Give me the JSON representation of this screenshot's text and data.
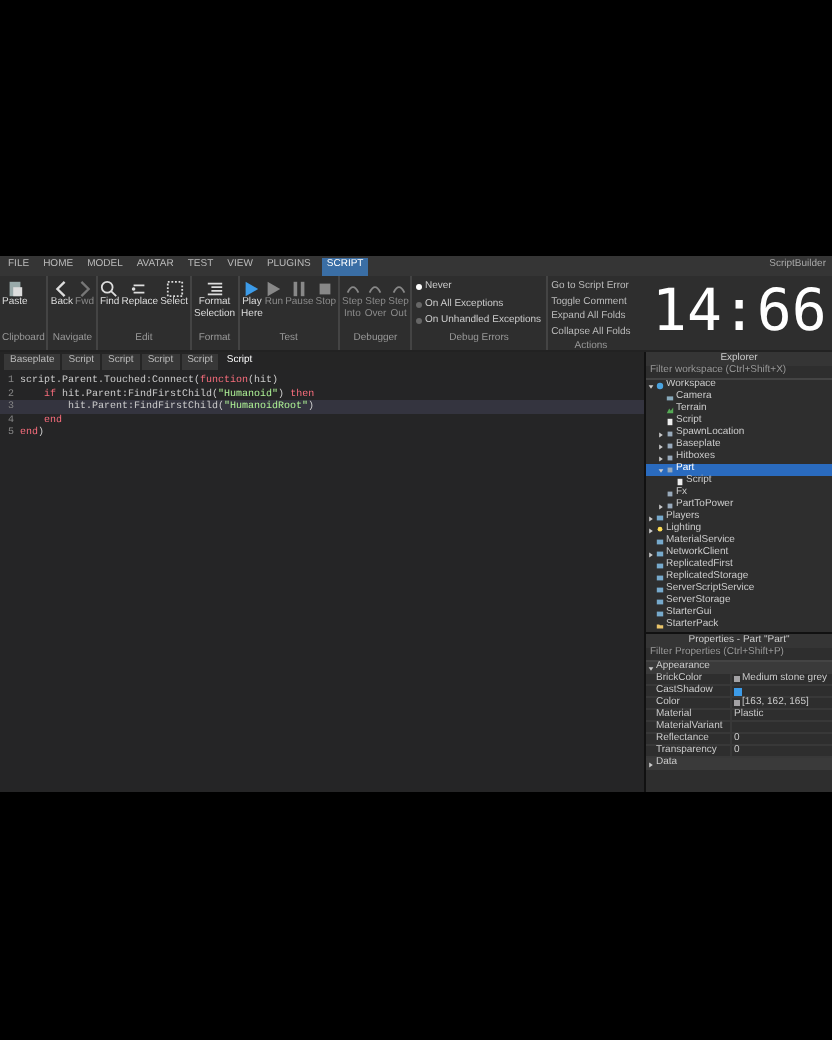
{
  "menu_tabs": [
    {
      "label": "FILE",
      "selected": false
    },
    {
      "label": "HOME",
      "selected": false
    },
    {
      "label": "MODEL",
      "selected": false
    },
    {
      "label": "AVATAR",
      "selected": false
    },
    {
      "label": "TEST",
      "selected": false
    },
    {
      "label": "VIEW",
      "selected": false
    },
    {
      "label": "PLUGINS",
      "selected": false
    },
    {
      "label": "SCRIPT",
      "selected": true
    }
  ],
  "ribbon_groups": [
    {
      "label": "Clipboard",
      "buttons": [
        {
          "label": "Paste",
          "kind": "paste",
          "disabled": false
        }
      ]
    },
    {
      "label": "Navigate",
      "buttons": [
        {
          "label": "Back",
          "kind": "back",
          "disabled": false
        },
        {
          "label": "Fwd",
          "kind": "forward",
          "disabled": true
        }
      ]
    },
    {
      "label": "Edit",
      "buttons": [
        {
          "label": "Find",
          "kind": "find",
          "disabled": false
        },
        {
          "label": "Replace",
          "kind": "replace",
          "disabled": false
        },
        {
          "label": "Select",
          "kind": "select",
          "disabled": false
        }
      ]
    },
    {
      "label": "Format",
      "buttons": [
        {
          "label": "Format Selection",
          "kind": "format",
          "disabled": false
        }
      ]
    },
    {
      "label": "Test",
      "buttons": [
        {
          "label": "Play Here",
          "kind": "play",
          "disabled": false
        },
        {
          "label": "Run",
          "kind": "run",
          "disabled": true
        },
        {
          "label": "Pause",
          "kind": "pause",
          "disabled": true
        },
        {
          "label": "Stop",
          "kind": "stop",
          "disabled": true
        }
      ]
    },
    {
      "label": "Debugger",
      "buttons": [
        {
          "label": "Step Into",
          "kind": "step",
          "disabled": true
        },
        {
          "label": "Step Over",
          "kind": "step",
          "disabled": true
        },
        {
          "label": "Step Out",
          "kind": "step",
          "disabled": true
        }
      ]
    }
  ],
  "debug_errors": {
    "label": "Debug Errors",
    "options": [
      {
        "label": "Never",
        "selected": true
      },
      {
        "label": "On All Exceptions",
        "selected": false
      },
      {
        "label": "On Unhandled Exceptions",
        "selected": false
      }
    ]
  },
  "actions": {
    "label": "Actions",
    "items": [
      "Go to Script Error",
      "Toggle Comment",
      "Expand All Folds",
      "Collapse All Folds"
    ]
  },
  "user": "ScriptBuilder",
  "editor_tabs": [
    {
      "label": "Baseplate",
      "selected": false
    },
    {
      "label": "Script",
      "selected": false
    },
    {
      "label": "Script",
      "selected": false
    },
    {
      "label": "Script",
      "selected": false
    },
    {
      "label": "Script",
      "selected": false
    },
    {
      "label": "Script",
      "selected": true
    }
  ],
  "code_lines": [
    {
      "number": "1",
      "current": false,
      "tokens": [
        {
          "text": "script.Parent.Touched:Connect(",
          "kind": "plain"
        },
        {
          "text": "function",
          "kind": "keyword"
        },
        {
          "text": "(hit)",
          "kind": "plain"
        }
      ]
    },
    {
      "number": "2",
      "current": false,
      "tokens": [
        {
          "text": "    if",
          "kind": "keyword"
        },
        {
          "text": " hit.Parent:FindFirstChild(",
          "kind": "plain"
        },
        {
          "text": "\"Humanoid\"",
          "kind": "string"
        },
        {
          "text": ") ",
          "kind": "plain"
        },
        {
          "text": "then",
          "kind": "keyword"
        }
      ]
    },
    {
      "number": "3",
      "current": true,
      "tokens": [
        {
          "text": "        hit.Parent:FindFirstChild(",
          "kind": "plain"
        },
        {
          "text": "\"HumanoidRoot\"",
          "kind": "string"
        },
        {
          "text": ")",
          "kind": "plain"
        }
      ]
    },
    {
      "number": "4",
      "current": false,
      "tokens": [
        {
          "text": "    end",
          "kind": "keyword"
        }
      ]
    },
    {
      "number": "5",
      "current": false,
      "tokens": [
        {
          "text": "end",
          "kind": "keyword"
        },
        {
          "text": ")",
          "kind": "plain"
        }
      ]
    }
  ],
  "explorer": {
    "title": "Explorer",
    "filter": "Filter workspace (Ctrl+Shift+X)",
    "items": [
      {
        "label": "Workspace",
        "kind": "world",
        "expanded": true,
        "selected": false,
        "children": [
          {
            "label": "Camera",
            "kind": "camera",
            "selected": false
          },
          {
            "label": "Terrain",
            "kind": "terrain",
            "selected": false
          },
          {
            "label": "Script",
            "kind": "script",
            "selected": false
          },
          {
            "label": "SpawnLocation",
            "kind": "part",
            "expanded": false,
            "selected": false
          },
          {
            "label": "Baseplate",
            "kind": "part",
            "expanded": false,
            "selected": false
          },
          {
            "label": "Hitboxes",
            "kind": "part",
            "expanded": false,
            "selected": false
          },
          {
            "label": "Part",
            "kind": "part",
            "expanded": true,
            "selected": true,
            "children": [
              {
                "label": "Script",
                "kind": "script",
                "selected": false
              }
            ]
          },
          {
            "label": "Fx",
            "kind": "part",
            "selected": false
          },
          {
            "label": "PartToPower",
            "kind": "part",
            "expanded": false,
            "selected": false
          }
        ]
      },
      {
        "label": "Players",
        "kind": "service",
        "expanded": false,
        "selected": false
      },
      {
        "label": "Lighting",
        "kind": "light",
        "expanded": false,
        "selected": false
      },
      {
        "label": "MaterialService",
        "kind": "service",
        "selected": false
      },
      {
        "label": "NetworkClient",
        "kind": "service",
        "expanded": false,
        "selected": false
      },
      {
        "label": "ReplicatedFirst",
        "kind": "service",
        "selected": false
      },
      {
        "label": "ReplicatedStorage",
        "kind": "service",
        "selected": false
      },
      {
        "label": "ServerScriptService",
        "kind": "service",
        "selected": false
      },
      {
        "label": "ServerStorage",
        "kind": "service",
        "selected": false
      },
      {
        "label": "StarterGui",
        "kind": "service",
        "selected": false
      },
      {
        "label": "StarterPack",
        "kind": "folder",
        "selected": false
      }
    ]
  },
  "properties": {
    "title": "Properties - Part \"Part\"",
    "filter": "Filter Properties (Ctrl+Shift+P)",
    "sections": [
      {
        "label": "Appearance",
        "expanded": true,
        "rows": [
          {
            "name": "BrickColor",
            "value": "Medium stone grey",
            "kind": "color",
            "color": "#a3a2a5"
          },
          {
            "name": "CastShadow",
            "kind": "checkbox",
            "checked": true
          },
          {
            "name": "Color",
            "value": "[163, 162, 165]",
            "kind": "color",
            "color": "#a3a2a5"
          },
          {
            "name": "Material",
            "value": "Plastic",
            "kind": "text"
          },
          {
            "name": "MaterialVariant",
            "kind": "text"
          },
          {
            "name": "Reflectance",
            "value": "0",
            "kind": "text"
          },
          {
            "name": "Transparency",
            "value": "0",
            "kind": "text"
          }
        ]
      },
      {
        "label": "Data",
        "expanded": false
      }
    ]
  },
  "timer": "14:66"
}
